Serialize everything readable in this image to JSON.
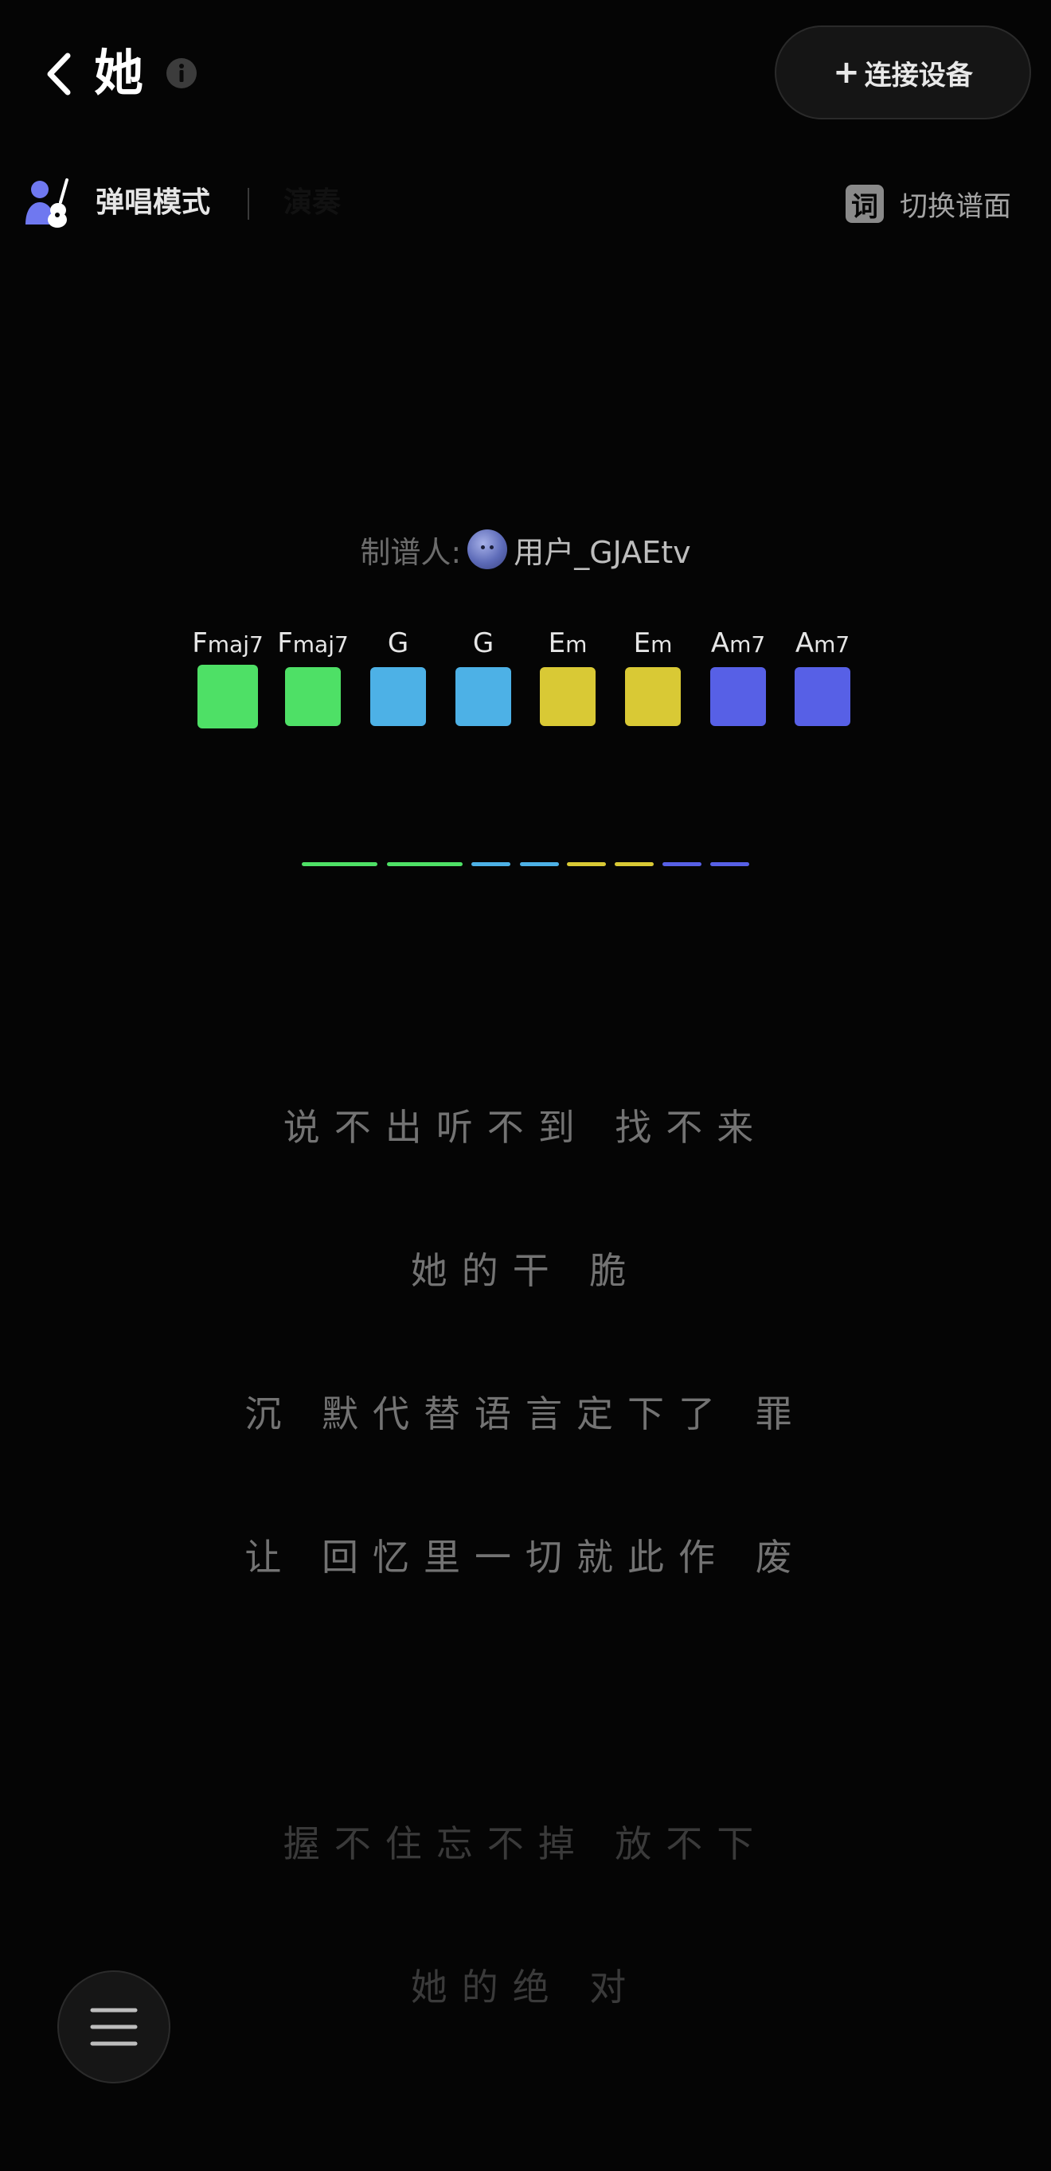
{
  "header": {
    "title": "她",
    "connect_button": {
      "plus": "+",
      "label": "连接设备"
    }
  },
  "mode_bar": {
    "mode_label": "弹唱模式",
    "faint_tab": "演奏",
    "switch_badge": "词",
    "switch_label": "切换谱面"
  },
  "author": {
    "prefix": "制谱人:",
    "name": "用户_GJAEtv"
  },
  "chords": [
    {
      "root": "F",
      "suffix": "maj7",
      "color": "#4ee066",
      "active": true
    },
    {
      "root": "F",
      "suffix": "maj7",
      "color": "#4ee066",
      "active": false
    },
    {
      "root": "G",
      "suffix": "",
      "color": "#4db1e6",
      "active": false
    },
    {
      "root": "G",
      "suffix": "",
      "color": "#4db1e6",
      "active": false
    },
    {
      "root": "E",
      "suffix": "m",
      "color": "#d9c935",
      "active": false
    },
    {
      "root": "E",
      "suffix": "m",
      "color": "#d9c935",
      "active": false
    },
    {
      "root": "A",
      "suffix": "m7",
      "color": "#5760e6",
      "active": false
    },
    {
      "root": "A",
      "suffix": "m7",
      "color": "#5760e6",
      "active": false
    }
  ],
  "progress": [
    {
      "color": "#4ee066"
    },
    {
      "color": "#4ee066"
    },
    {
      "color": "#4db1e6"
    },
    {
      "color": "#4db1e6"
    },
    {
      "color": "#d9c935"
    },
    {
      "color": "#d9c935"
    },
    {
      "color": "#5760e6"
    },
    {
      "color": "#5760e6"
    }
  ],
  "lyrics": [
    {
      "text": "说不出听不到 找不来",
      "tone": "near"
    },
    {
      "text": "她的干 脆",
      "tone": "near"
    },
    {
      "text": "沉 默代替语言定下了 罪",
      "tone": "near"
    },
    {
      "text": "让 回忆里一切就此作 废",
      "tone": "near"
    },
    {
      "text": "握不住忘不掉 放不下",
      "tone": "far"
    },
    {
      "text": "她的绝 对",
      "tone": "far"
    }
  ],
  "colors": {
    "background": "#050505",
    "accent_green": "#4ee066",
    "accent_blue": "#4db1e6",
    "accent_yellow": "#d9c935",
    "accent_indigo": "#5760e6"
  },
  "icons": {
    "back": "chevron-left-icon",
    "info": "info-icon",
    "mode": "guitar-person-icon",
    "menu": "hamburger-menu-icon"
  }
}
